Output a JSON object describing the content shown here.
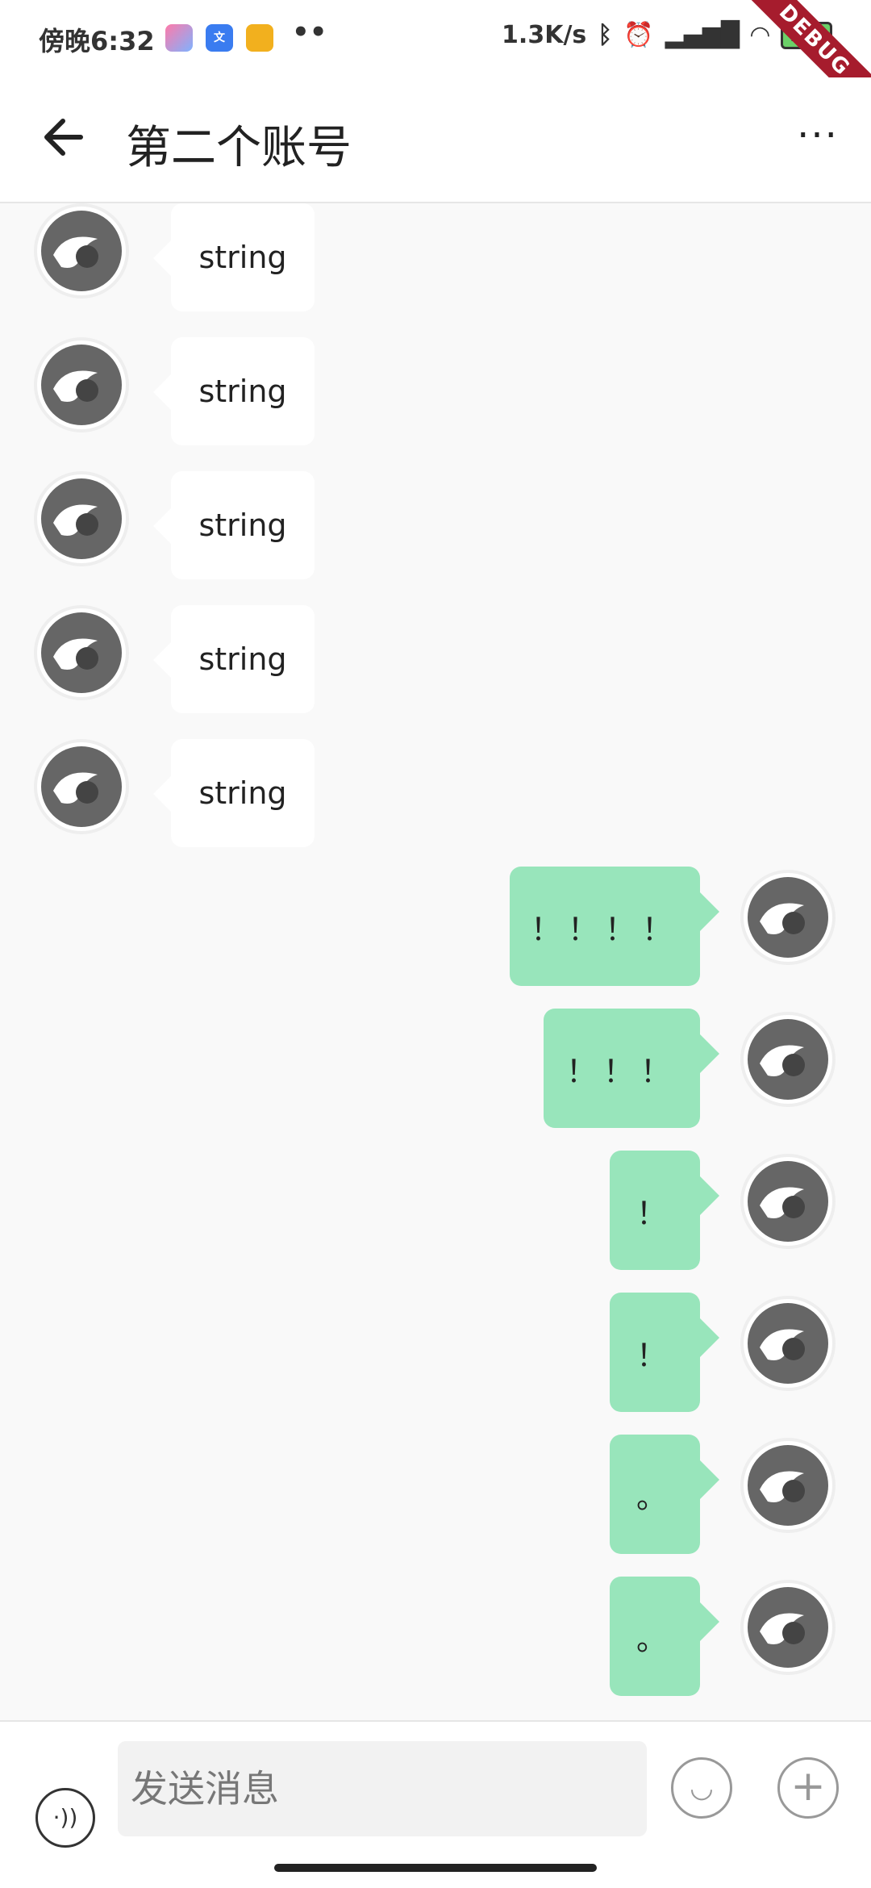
{
  "status_bar": {
    "time": "傍晚6:32",
    "network_speed": "1.3K/s",
    "battery": "100",
    "debug_label": "DEBUG",
    "app_icons": [
      "game-icon",
      "translate-icon",
      "mail-icon"
    ],
    "more_dots": "••"
  },
  "app_bar": {
    "title": "第二个账号",
    "more_label": "···"
  },
  "messages_incoming": [
    {
      "text": "string"
    },
    {
      "text": "string"
    },
    {
      "text": "string"
    },
    {
      "text": "string"
    },
    {
      "text": "string"
    }
  ],
  "messages_outgoing": [
    {
      "text": "！！！！"
    },
    {
      "text": "！！！"
    },
    {
      "text": "！"
    },
    {
      "text": "！"
    },
    {
      "text": "。"
    },
    {
      "text": "。"
    }
  ],
  "input_bar": {
    "placeholder": "发送消息"
  },
  "colors": {
    "outgoing_bubble": "#98e5bb",
    "incoming_bubble": "#ffffff",
    "debug_ribbon": "#a61c2d"
  }
}
